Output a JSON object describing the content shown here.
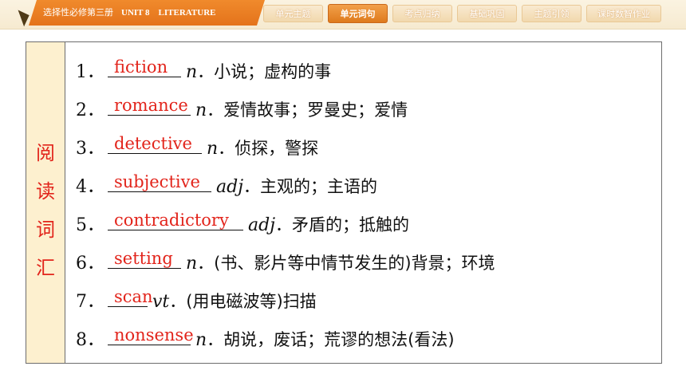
{
  "header": {
    "breadcrumb_cn": "选择性必修第三册",
    "breadcrumb_en": "UNIT 8　LITERATURE",
    "tabs": [
      {
        "label": "单元主题"
      },
      {
        "label": "单元词句"
      },
      {
        "label": "考点归纳"
      },
      {
        "label": "基础巩固"
      },
      {
        "label": "主题引领"
      },
      {
        "label": "课时数智作业"
      }
    ]
  },
  "section": {
    "side_label": [
      "阅",
      "读",
      "词",
      "汇"
    ]
  },
  "rows": [
    {
      "num": "1．",
      "answer": "fiction",
      "pos": "n",
      "def": "．小说；虚构的事"
    },
    {
      "num": "2．",
      "answer": "romance",
      "pos": "n",
      "def": "．爱情故事；罗曼史；爱情"
    },
    {
      "num": "3．",
      "answer": "detective",
      "pos": "n",
      "def": "．侦探，警探"
    },
    {
      "num": "4．",
      "answer": "subjective",
      "pos": "adj",
      "def": "．主观的；主语的"
    },
    {
      "num": "5．",
      "answer": "contradictory",
      "pos": "adj",
      "def": "．矛盾的；抵触的"
    },
    {
      "num": "6．",
      "answer": "setting",
      "pos": "n",
      "def": "．(书、影片等中情节发生的)背景；环境"
    },
    {
      "num": "7．",
      "answer": "scan",
      "pos": "vt",
      "def": "．(用电磁波等)扫描"
    },
    {
      "num": "8．",
      "answer": "nonsense",
      "pos": "n",
      "def": "．胡说，废话；荒谬的想法(看法)"
    }
  ]
}
